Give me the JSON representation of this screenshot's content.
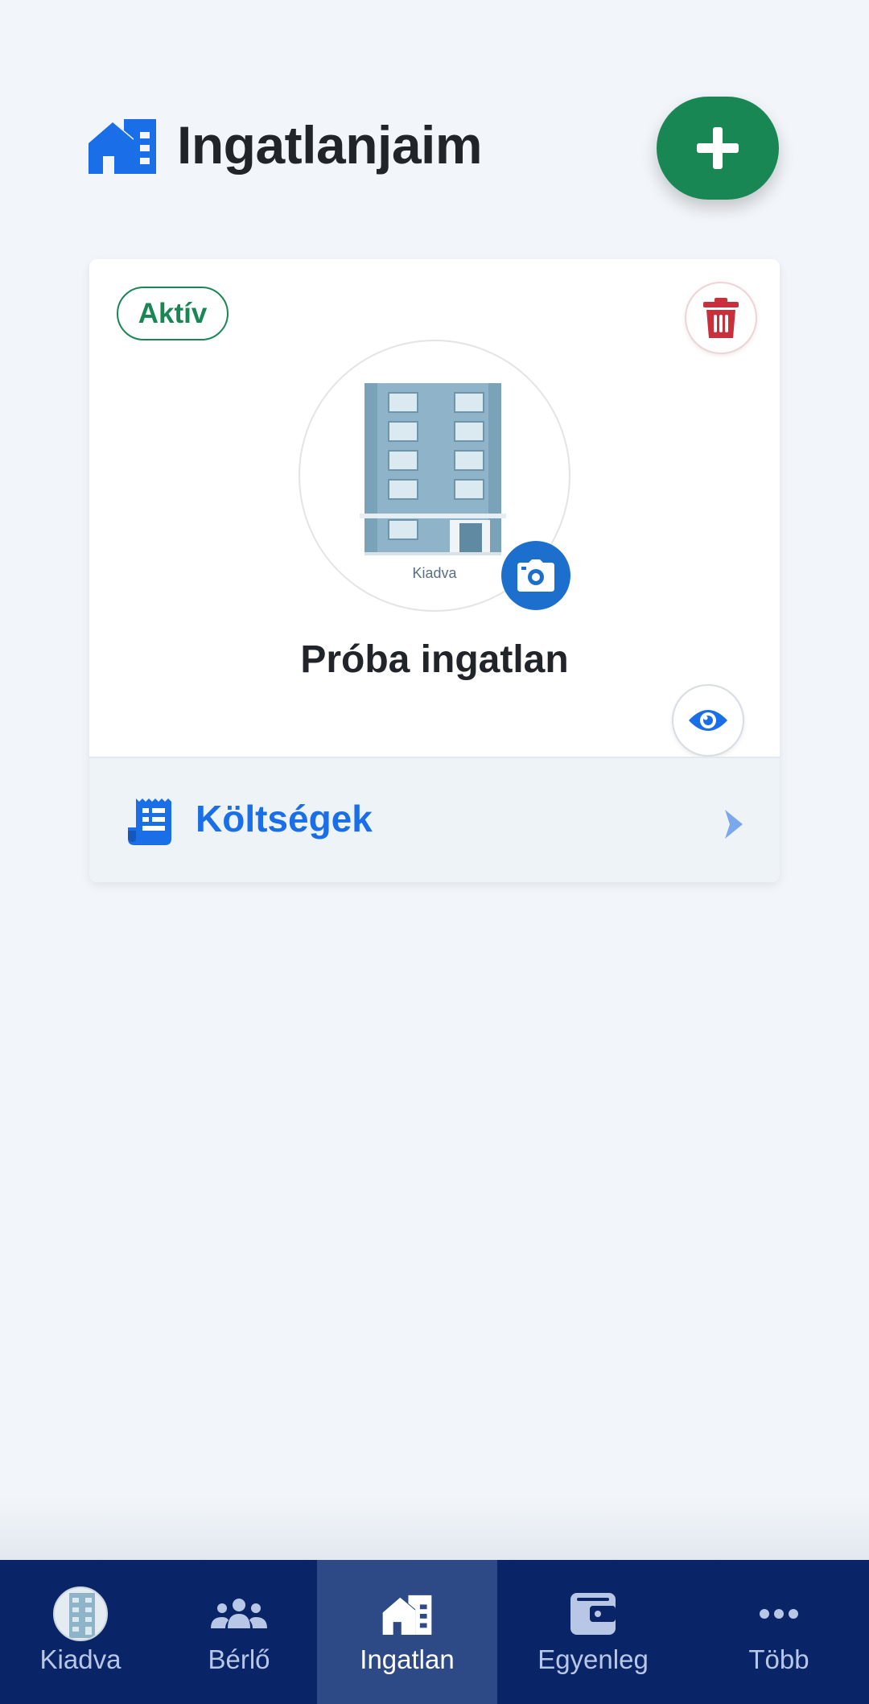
{
  "header": {
    "title": "Ingatlanjaim",
    "icon": "house-building-icon",
    "add_icon": "plus-icon"
  },
  "property_card": {
    "status": "Aktív",
    "name": "Próba ingatlan",
    "photo_caption": "Kiadva",
    "delete_icon": "trash-icon",
    "camera_icon": "camera-icon",
    "view_icon": "eye-icon",
    "costs": {
      "label": "Költségek",
      "icon": "receipt-icon",
      "chevron_icon": "chevron-right-icon"
    }
  },
  "bottom_nav": {
    "items": [
      {
        "label": "Kiadva",
        "icon": "avatar"
      },
      {
        "label": "Bérlő",
        "icon": "users-icon"
      },
      {
        "label": "Ingatlan",
        "icon": "house-building-icon",
        "active": true
      },
      {
        "label": "Egyenleg",
        "icon": "wallet-icon"
      },
      {
        "label": "Több",
        "icon": "more-icon"
      }
    ]
  },
  "colors": {
    "primary": "#1a6ee8",
    "success": "#198754",
    "danger": "#c9303c",
    "nav_bg": "#0a2468",
    "nav_active_bg": "#2d4a86",
    "page_bg": "#f2f6fa"
  }
}
